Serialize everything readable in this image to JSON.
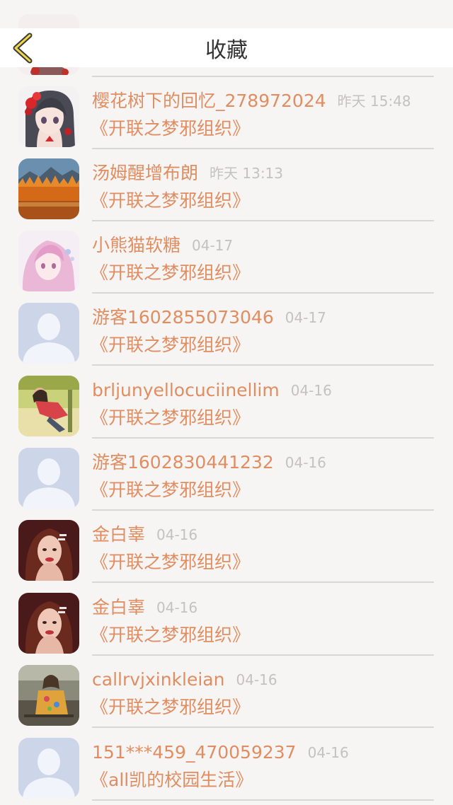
{
  "header": {
    "title": "收藏",
    "back_icon": "chevron-left-icon"
  },
  "colors": {
    "accent": "#e08e61",
    "time_text": "#c4c1c1",
    "divider": "#d9d6d6",
    "background": "#f7f4f4",
    "header_bg": "#ffffff"
  },
  "items": [
    {
      "name": "樱花树下的回忆_278972024",
      "time": "昨天 15:48",
      "book": "《开联之梦邪组织》",
      "avatar": "anime-girl-red-flowers"
    },
    {
      "name": "汤姆醒增布朗",
      "time": "昨天 13:13",
      "book": "《开联之梦邪组织》",
      "avatar": "autumn-landscape"
    },
    {
      "name": "小熊猫软糖",
      "time": "04-17",
      "book": "《开联之梦邪组织》",
      "avatar": "anime-girl-pink-hair"
    },
    {
      "name": "游客1602855073046",
      "time": "04-17",
      "book": "《开联之梦邪组织》",
      "avatar": "default-user"
    },
    {
      "name": "brljunyellocuciinellim",
      "time": "04-16",
      "book": "《开联之梦邪组织》",
      "avatar": "person-outdoor"
    },
    {
      "name": "游客1602830441232",
      "time": "04-16",
      "book": "《开联之梦邪组织》",
      "avatar": "default-user"
    },
    {
      "name": "金白辜",
      "time": "04-16",
      "book": "《开联之梦邪组织》",
      "avatar": "woman-portrait"
    },
    {
      "name": "金白辜",
      "time": "04-16",
      "book": "《开联之梦邪组织》",
      "avatar": "woman-portrait"
    },
    {
      "name": "callrvjxinkleian",
      "time": "04-16",
      "book": "《开联之梦邪组织》",
      "avatar": "woman-outdoor"
    },
    {
      "name": "151***459_470059237",
      "time": "04-16",
      "book": "《all凯的校园生活》",
      "avatar": "default-user"
    }
  ]
}
